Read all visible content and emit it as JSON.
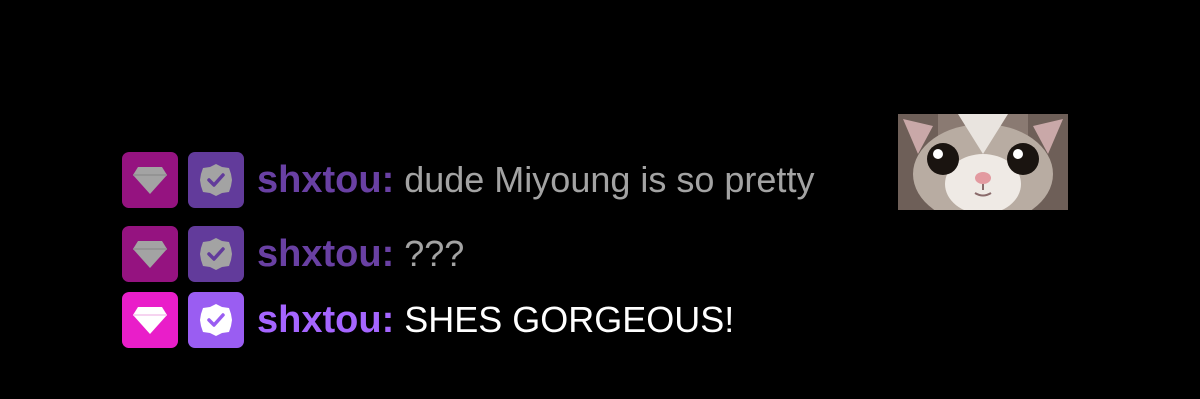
{
  "messages": [
    {
      "username": "shxtou",
      "separator": ":",
      "text": "dude Miyoung is so pretty",
      "emote": "cat-emote",
      "faded": true
    },
    {
      "username": "shxtou",
      "separator": ":",
      "text": "???",
      "faded": true
    },
    {
      "username": "shxtou",
      "separator": ":",
      "text": "SHES GORGEOUS!",
      "faded": false
    }
  ],
  "badges": {
    "subscriber_icon": "diamond-icon",
    "verified_icon": "checkmark-icon"
  },
  "colors": {
    "background": "#000000",
    "username": "#a565ff",
    "message_text": "#ffffff",
    "sub_badge": "#e91ec9",
    "verified_badge": "#9a5df2"
  }
}
